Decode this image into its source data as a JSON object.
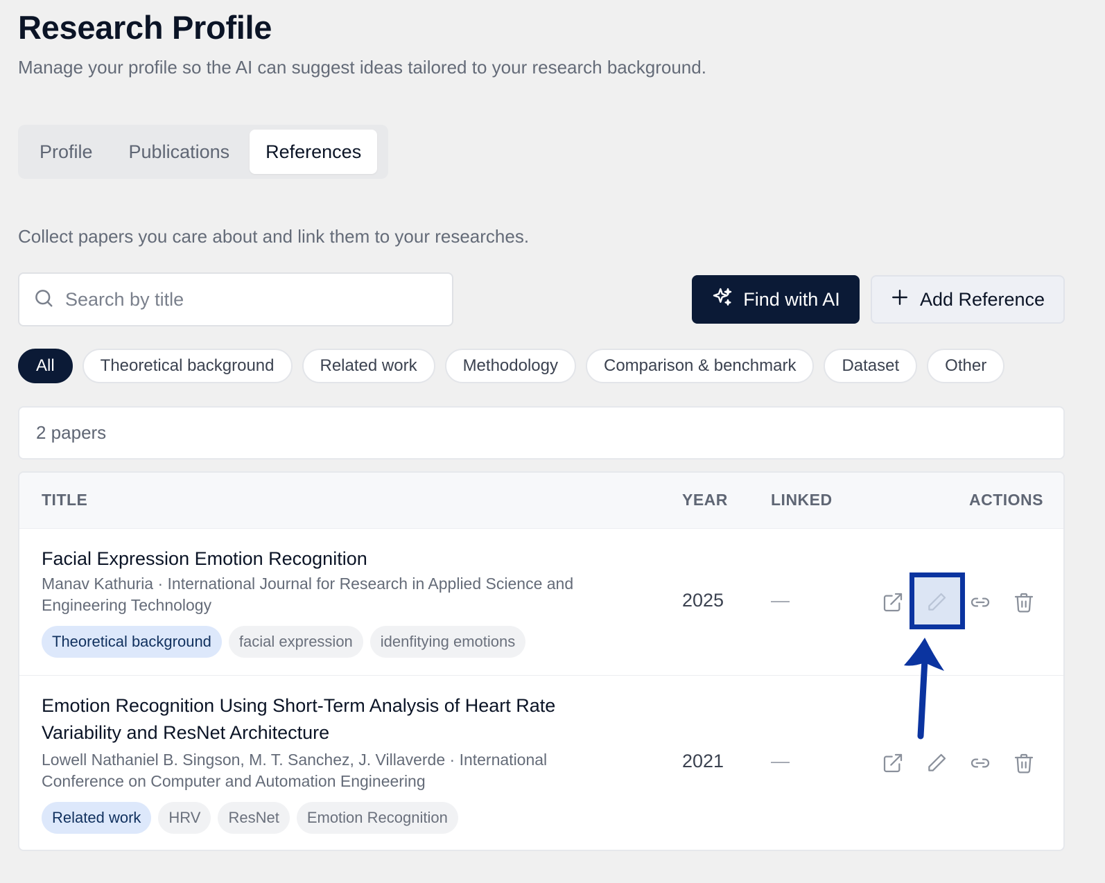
{
  "page": {
    "title": "Research Profile",
    "subtitle": "Manage your profile so the AI can suggest ideas tailored to your research background."
  },
  "tabs": [
    {
      "label": "Profile",
      "active": false
    },
    {
      "label": "Publications",
      "active": false
    },
    {
      "label": "References",
      "active": true
    }
  ],
  "references": {
    "description": "Collect papers you care about and link them to your researches.",
    "search_placeholder": "Search by title",
    "find_ai_label": "Find with AI",
    "add_reference_label": "Add Reference",
    "filters": [
      "All",
      "Theoretical background",
      "Related work",
      "Methodology",
      "Comparison & benchmark",
      "Dataset",
      "Other"
    ],
    "active_filter": "All",
    "count_label": "2 papers"
  },
  "table": {
    "headers": {
      "title": "TITLE",
      "year": "YEAR",
      "linked": "LINKED",
      "actions": "ACTIONS"
    },
    "rows": [
      {
        "title": "Facial Expression Emotion Recognition",
        "meta": "Manav Kathuria · International Journal for Research in Applied Science and Engineering Technology",
        "tags": [
          "Theoretical background",
          "facial expression",
          "idenfitying emotions"
        ],
        "year": "2025",
        "linked": "—"
      },
      {
        "title": "Emotion Recognition Using Short-Term Analysis of Heart Rate Variability and ResNet Architecture",
        "meta": "Lowell Nathaniel B. Singson, M. T. Sanchez, J. Villaverde · International Conference on Computer and Automation Engineering",
        "tags": [
          "Related work",
          "HRV",
          "ResNet",
          "Emotion Recognition"
        ],
        "year": "2021",
        "linked": "—"
      }
    ]
  },
  "icons": {
    "search": "search-icon",
    "sparkle": "sparkle-icon",
    "plus": "plus-icon",
    "open": "external-link-icon",
    "edit": "pencil-icon",
    "link": "link-icon",
    "delete": "trash-icon"
  },
  "colors": {
    "primary_dark": "#0b1a36",
    "background": "#f0f0f0",
    "tag_primary_bg": "#dde8fb",
    "annotation_blue": "#0b34a0"
  }
}
